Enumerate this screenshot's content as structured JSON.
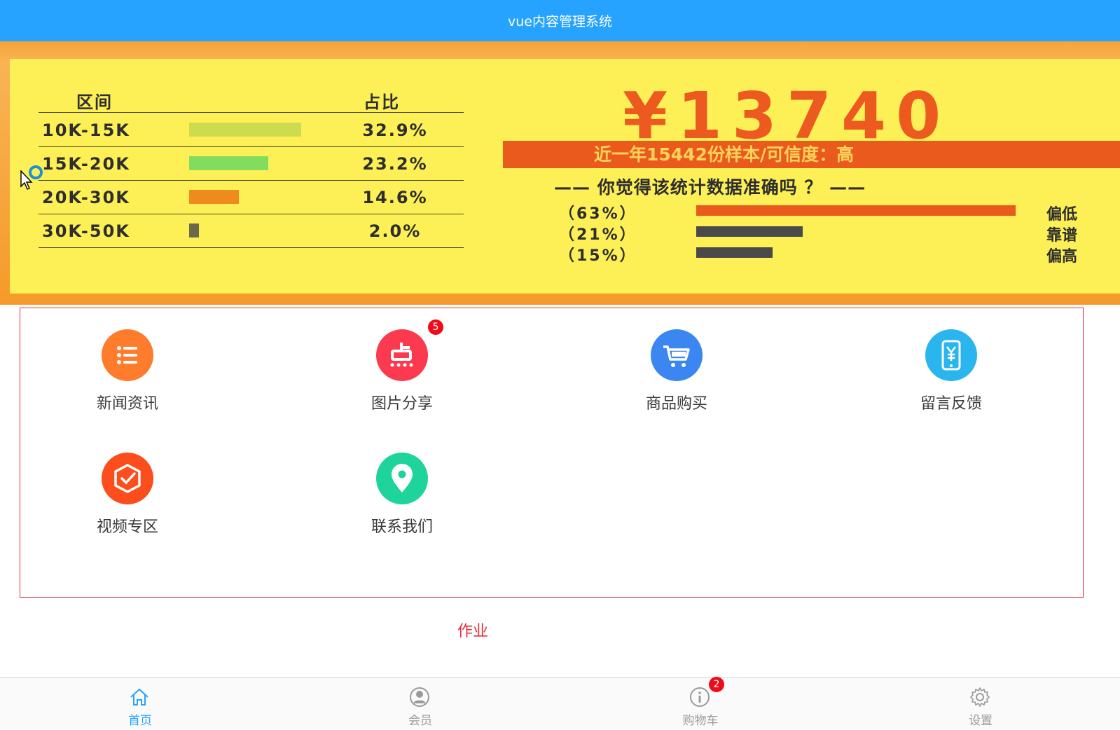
{
  "header": {
    "title": "vue内容管理系统"
  },
  "banner": {
    "table": {
      "col_range": "区间",
      "col_ratio": "占比",
      "rows": [
        {
          "label": "10K-15K",
          "pct": "32.9%",
          "bar_color": "#cedb4f",
          "bar_value": 32.9
        },
        {
          "label": "15K-20K",
          "pct": "23.2%",
          "bar_color": "#82dc5e",
          "bar_value": 23.2
        },
        {
          "label": "20K-30K",
          "pct": "14.6%",
          "bar_color": "#ef8a1f",
          "bar_value": 14.6
        },
        {
          "label": "30K-50K",
          "pct": "2.0%",
          "bar_color": "#6a6a4a",
          "bar_value": 2.0
        }
      ]
    },
    "price": "¥13740",
    "strip_text": "近一年15442份样本/可信度：高",
    "question": "—— 你觉得该统计数据准确吗 ？ ——",
    "poll": [
      {
        "pct": "（63%）",
        "value": 63,
        "color": "#ea5a1c",
        "text": "偏低"
      },
      {
        "pct": "（21%）",
        "value": 21,
        "color": "#4a4a4a",
        "text": "靠谱"
      },
      {
        "pct": "（15%）",
        "value": 15,
        "color": "#4a4a4a",
        "text": "偏高"
      }
    ],
    "carousel_count": 2,
    "carousel_active": 0
  },
  "grid": {
    "items": [
      {
        "label": "新闻资讯",
        "color": "#fe7c2b",
        "icon": "list-icon"
      },
      {
        "label": "图片分享",
        "color": "#fc3a4f",
        "icon": "dian-icon",
        "badge": "5"
      },
      {
        "label": "商品购买",
        "color": "#3c86f2",
        "icon": "cart-icon"
      },
      {
        "label": "留言反馈",
        "color": "#2ab5ee",
        "icon": "phone-yen-icon"
      },
      {
        "label": "视频专区",
        "color": "#fc4d1c",
        "icon": "check-shield-icon"
      },
      {
        "label": "联系我们",
        "color": "#1fd49b",
        "icon": "location-pin-icon"
      }
    ]
  },
  "homework": "作业",
  "tabbar": {
    "tabs": [
      {
        "label": "首页",
        "icon": "home-icon",
        "active": true
      },
      {
        "label": "会员",
        "icon": "user-icon",
        "active": false
      },
      {
        "label": "购物车",
        "icon": "info-icon",
        "active": false,
        "badge": "2"
      },
      {
        "label": "设置",
        "icon": "gear-icon",
        "active": false
      }
    ]
  },
  "colors": {
    "header_bg": "#26a2ff",
    "active_tab": "#26a2ff",
    "grid_border": "#e0303a",
    "badge": "#ef0b1a"
  }
}
